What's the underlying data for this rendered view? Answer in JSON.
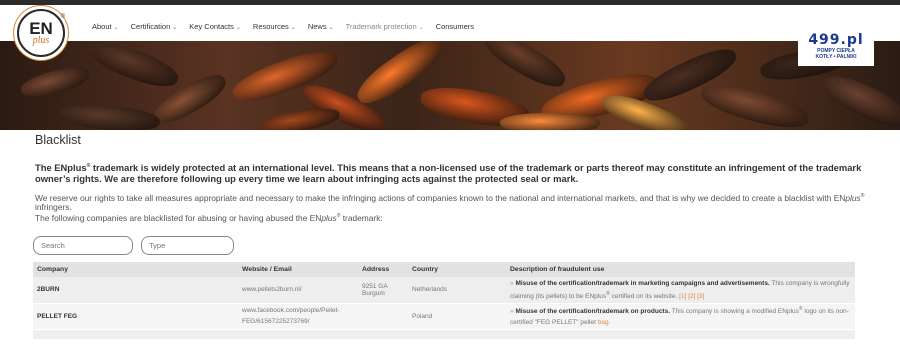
{
  "header": {
    "logo": {
      "main": "EN",
      "sub": "plus",
      "reg": "®"
    },
    "menu": [
      {
        "label": "About",
        "has_dropdown": true
      },
      {
        "label": "Certification",
        "has_dropdown": true
      },
      {
        "label": "Key Contacts",
        "has_dropdown": true
      },
      {
        "label": "Resources",
        "has_dropdown": true
      },
      {
        "label": "News",
        "has_dropdown": true
      },
      {
        "label": "Trademark protection",
        "has_dropdown": true,
        "active": true
      },
      {
        "label": "Consumers",
        "has_dropdown": false
      }
    ],
    "ad": {
      "logo": "499.pl",
      "line1": "POMPY CIEPŁA",
      "line2": "KOTŁY • PALNIKI"
    }
  },
  "page": {
    "title": "Blacklist",
    "intro": {
      "p1": "The ENplus",
      "p2": " trademark is widely protected at an international level. This means that a non-licensed use of the trademark or parts thereof may constitute an infringement of the trademark owner’s rights. We are therefore following up every time we learn about infringing acts against the protected seal or mark."
    },
    "paragraph1": {
      "a": "We reserve our rights to take all measures appropriate and necessary to make the infringing actions of companies known to the national and international markets, and that is why we decided to create a blacklist with EN",
      "b": "plus",
      "c": " infringers."
    },
    "paragraph2": {
      "a": "The following companies are blacklisted for abusing or having abused the EN",
      "b": "plus",
      "c": " trademark:"
    },
    "reg": "®"
  },
  "filters": {
    "search_placeholder": "Search",
    "type_placeholder": "Type"
  },
  "table": {
    "headers": [
      "Company",
      "Website / Email",
      "Address",
      "Country",
      "Description of fraudulent use"
    ],
    "rows": [
      {
        "company": "2BURN",
        "website": "www.pellets2burn.nl/",
        "website2": "",
        "address": "9251 GA Burgum",
        "country": "Netherlands",
        "desc_bold": "Misuse of the certification/trademark in marketing campaigns and advertisements.",
        "desc_rest_1": " This company is wrongfully claiming (its pellets) to be ENplus",
        "desc_rest_2": " certified on its website.",
        "refs": "[1] [2] [3]"
      },
      {
        "company": "PELLET FEG",
        "website": "www.facebook.com/people/Pellet-",
        "website2": "FEG/61567225273769/",
        "address": "",
        "country": "Poland",
        "desc_bold": "Misuse of the certification/trademark on products.",
        "desc_rest_1": " This company is showing a modified ENplus",
        "desc_rest_2": " logo on its non-certified \"FEG PELLET\" pellet",
        "refs": "bag."
      }
    ]
  },
  "colors": {
    "accent": "#e08a3c",
    "header_bg": "#e2e2e2",
    "row_bg": "#eeeeee",
    "ad_blue": "#1a3a8f"
  }
}
